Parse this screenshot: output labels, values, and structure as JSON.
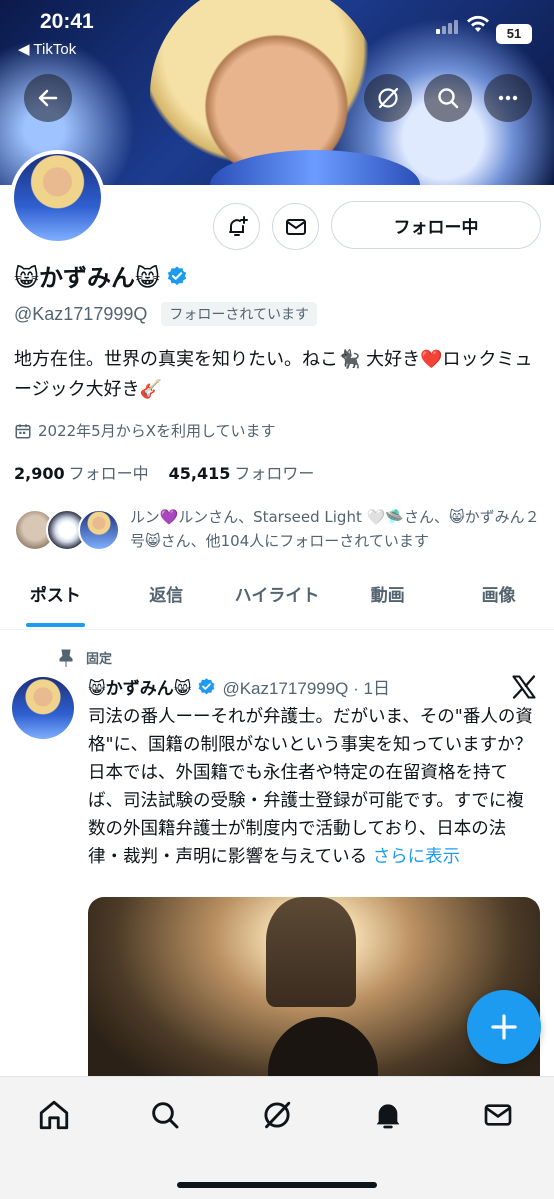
{
  "status_bar": {
    "time": "20:41",
    "back_app": "◀ TikTok",
    "battery": "51"
  },
  "profile": {
    "display_name": "😸かずみん😸",
    "handle": "@Kaz1717999Q",
    "follows_you": "フォローされています",
    "bio": "地方在住。世界の真実を知りたい。ねこ🐈‍⬛ 大好き❤️ロックミュージック大好き🎸",
    "joined": "2022年5月からXを利用しています",
    "following_count": "2,900",
    "following_label": "フォロー中",
    "followers_count": "45,415",
    "followers_label": "フォロワー",
    "followed_by_text": "ルン💜ルンさん、Starseed Light 🤍🛸さん、😸かずみん２号😸さん、他104人にフォローされています",
    "follow_button": "フォロー中"
  },
  "tabs": [
    {
      "label": "ポスト",
      "active": true
    },
    {
      "label": "返信"
    },
    {
      "label": "ハイライト"
    },
    {
      "label": "動画"
    },
    {
      "label": "画像"
    }
  ],
  "post": {
    "pinned_label": "固定",
    "author_name": "😸かずみん😸",
    "author_handle_time": "@Kaz1717999Q · 1日",
    "body": "司法の番人ーーそれが弁護士。だがいま、その\"番人の資格\"に、国籍の制限がないという事実を知っていますか？日本では、外国籍でも永住者や特定の在留資格を持てば、司法試験の受験・弁護士登録が可能です。すでに複数の外国籍弁護士が制度内で活動しており、日本の法律・裁判・声明に影響を与えている ",
    "show_more": "さらに表示"
  },
  "icons": {
    "back": "arrow-left-icon",
    "grok": "grok-icon",
    "search": "search-icon",
    "more": "more-icon",
    "notify": "bell-plus-icon",
    "message": "envelope-icon",
    "verified": "verified-badge-icon",
    "calendar": "calendar-icon",
    "pin": "pin-icon",
    "x_logo": "x-logo-icon",
    "compose": "plus-icon"
  },
  "colors": {
    "accent": "#1d9bf0",
    "text": "#0f1419",
    "muted": "#536471"
  }
}
